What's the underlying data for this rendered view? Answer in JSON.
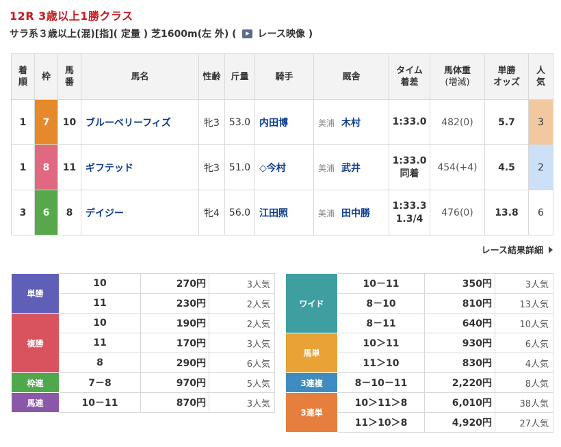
{
  "race": {
    "title": "12R 3歳以上1勝クラス",
    "conditions": "サラ系３歳以上(混)[指]( 定量 ) 芝1600m(左 外) (",
    "video_label": "レース映像 )",
    "detail_link": "レース結果詳細"
  },
  "results_table": {
    "headers": [
      {
        "line1": "着",
        "line2": "順"
      },
      {
        "line1": "枠",
        "line2": ""
      },
      {
        "line1": "馬",
        "line2": "番"
      },
      {
        "line1": "馬名",
        "line2": ""
      },
      {
        "line1": "性齢",
        "line2": ""
      },
      {
        "line1": "斤量",
        "line2": ""
      },
      {
        "line1": "騎手",
        "line2": ""
      },
      {
        "line1": "厩舎",
        "line2": ""
      },
      {
        "line1": "タイム",
        "line2": "着差"
      },
      {
        "line1": "馬体重",
        "line2": "(増減)"
      },
      {
        "line1": "単勝",
        "line2": "オッズ"
      },
      {
        "line1": "人",
        "line2": "気"
      }
    ],
    "rows": [
      {
        "place": "1",
        "frame": "7",
        "num": "10",
        "name": "ブルーベリーフィズ",
        "sexage": "牝3",
        "weight_carried": "53.0",
        "jockey": "内田博",
        "trainer_loc": "美浦",
        "trainer": "木村",
        "time": "1:33.0",
        "margin": "",
        "body_weight": "482(0)",
        "odds": "5.7",
        "pop": "3"
      },
      {
        "place": "1",
        "frame": "8",
        "num": "11",
        "name": "ギフテッド",
        "sexage": "牝3",
        "weight_carried": "51.0",
        "jockey": "◇今村",
        "trainer_loc": "美浦",
        "trainer": "武井",
        "time": "1:33.0",
        "margin": "同着",
        "body_weight": "454(+4)",
        "odds": "4.5",
        "pop": "2"
      },
      {
        "place": "3",
        "frame": "6",
        "num": "8",
        "name": "デイジー",
        "sexage": "牝4",
        "weight_carried": "56.0",
        "jockey": "江田照",
        "trainer_loc": "美浦",
        "trainer": "田中勝",
        "time": "1:33.3",
        "margin": "1.3/4",
        "body_weight": "476(0)",
        "odds": "13.8",
        "pop": "6"
      }
    ]
  },
  "payouts_left": {
    "tansho": {
      "label": "単勝",
      "rows": [
        {
          "combo": "10",
          "amount": "270円",
          "pop": "3人気"
        },
        {
          "combo": "11",
          "amount": "230円",
          "pop": "2人気"
        }
      ]
    },
    "fukusho": {
      "label": "複勝",
      "rows": [
        {
          "combo": "10",
          "amount": "190円",
          "pop": "2人気"
        },
        {
          "combo": "11",
          "amount": "170円",
          "pop": "3人気"
        },
        {
          "combo": "8",
          "amount": "290円",
          "pop": "6人気"
        }
      ]
    },
    "wakuren": {
      "label": "枠連",
      "rows": [
        {
          "combo": "7－8",
          "amount": "970円",
          "pop": "5人気"
        }
      ]
    },
    "umaren": {
      "label": "馬連",
      "rows": [
        {
          "combo": "10－11",
          "amount": "870円",
          "pop": "3人気"
        }
      ]
    }
  },
  "payouts_right": {
    "wide": {
      "label": "ワイド",
      "rows": [
        {
          "combo": "10－11",
          "amount": "350円",
          "pop": "3人気"
        },
        {
          "combo": "8－10",
          "amount": "810円",
          "pop": "13人気"
        },
        {
          "combo": "8－11",
          "amount": "640円",
          "pop": "10人気"
        }
      ]
    },
    "umatan": {
      "label": "馬単",
      "rows": [
        {
          "combo": "10＞11",
          "amount": "930円",
          "pop": "6人気"
        },
        {
          "combo": "11＞10",
          "amount": "830円",
          "pop": "4人気"
        }
      ]
    },
    "trio": {
      "label": "3連複",
      "rows": [
        {
          "combo": "8－10－11",
          "amount": "2,220円",
          "pop": "8人気"
        }
      ]
    },
    "trifecta": {
      "label": "3連単",
      "rows": [
        {
          "combo": "10＞11＞8",
          "amount": "6,010円",
          "pop": "38人気"
        },
        {
          "combo": "11＞10＞8",
          "amount": "4,920円",
          "pop": "27人気"
        }
      ]
    }
  },
  "colors": {
    "title_red": "#c8181e",
    "link_blue": "#0b3b8c",
    "frame_7": "#e6892a",
    "frame_8": "#e06880",
    "frame_6": "#57a84b",
    "popular_1st": "#f2c8a0",
    "popular_2nd": "#cce0f8",
    "tansho": "#5f5fb8",
    "fukusho": "#d9535e",
    "wakuren": "#4fa84b",
    "umaren": "#8b58a8",
    "wide": "#3f9fa0",
    "umatan": "#e8a235",
    "trio": "#3f8cc0",
    "trifecta": "#e67e3d"
  },
  "icons": {
    "video": "video-play-icon",
    "detail_arrow": "chevron-right-icon"
  }
}
